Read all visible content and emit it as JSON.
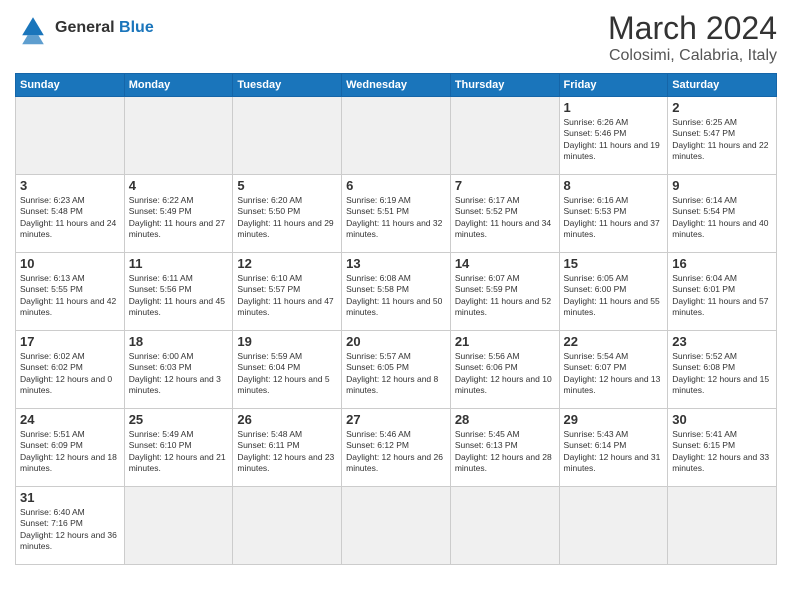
{
  "header": {
    "logo_line1": "General",
    "logo_line2": "Blue",
    "main_title": "March 2024",
    "subtitle": "Colosimi, Calabria, Italy"
  },
  "days_of_week": [
    "Sunday",
    "Monday",
    "Tuesday",
    "Wednesday",
    "Thursday",
    "Friday",
    "Saturday"
  ],
  "weeks": [
    [
      {
        "day": "",
        "info": "",
        "empty": true
      },
      {
        "day": "",
        "info": "",
        "empty": true
      },
      {
        "day": "",
        "info": "",
        "empty": true
      },
      {
        "day": "",
        "info": "",
        "empty": true
      },
      {
        "day": "",
        "info": "",
        "empty": true
      },
      {
        "day": "1",
        "info": "Sunrise: 6:26 AM\nSunset: 5:46 PM\nDaylight: 11 hours and 19 minutes.",
        "empty": false
      },
      {
        "day": "2",
        "info": "Sunrise: 6:25 AM\nSunset: 5:47 PM\nDaylight: 11 hours and 22 minutes.",
        "empty": false
      }
    ],
    [
      {
        "day": "3",
        "info": "Sunrise: 6:23 AM\nSunset: 5:48 PM\nDaylight: 11 hours and 24 minutes.",
        "empty": false
      },
      {
        "day": "4",
        "info": "Sunrise: 6:22 AM\nSunset: 5:49 PM\nDaylight: 11 hours and 27 minutes.",
        "empty": false
      },
      {
        "day": "5",
        "info": "Sunrise: 6:20 AM\nSunset: 5:50 PM\nDaylight: 11 hours and 29 minutes.",
        "empty": false
      },
      {
        "day": "6",
        "info": "Sunrise: 6:19 AM\nSunset: 5:51 PM\nDaylight: 11 hours and 32 minutes.",
        "empty": false
      },
      {
        "day": "7",
        "info": "Sunrise: 6:17 AM\nSunset: 5:52 PM\nDaylight: 11 hours and 34 minutes.",
        "empty": false
      },
      {
        "day": "8",
        "info": "Sunrise: 6:16 AM\nSunset: 5:53 PM\nDaylight: 11 hours and 37 minutes.",
        "empty": false
      },
      {
        "day": "9",
        "info": "Sunrise: 6:14 AM\nSunset: 5:54 PM\nDaylight: 11 hours and 40 minutes.",
        "empty": false
      }
    ],
    [
      {
        "day": "10",
        "info": "Sunrise: 6:13 AM\nSunset: 5:55 PM\nDaylight: 11 hours and 42 minutes.",
        "empty": false
      },
      {
        "day": "11",
        "info": "Sunrise: 6:11 AM\nSunset: 5:56 PM\nDaylight: 11 hours and 45 minutes.",
        "empty": false
      },
      {
        "day": "12",
        "info": "Sunrise: 6:10 AM\nSunset: 5:57 PM\nDaylight: 11 hours and 47 minutes.",
        "empty": false
      },
      {
        "day": "13",
        "info": "Sunrise: 6:08 AM\nSunset: 5:58 PM\nDaylight: 11 hours and 50 minutes.",
        "empty": false
      },
      {
        "day": "14",
        "info": "Sunrise: 6:07 AM\nSunset: 5:59 PM\nDaylight: 11 hours and 52 minutes.",
        "empty": false
      },
      {
        "day": "15",
        "info": "Sunrise: 6:05 AM\nSunset: 6:00 PM\nDaylight: 11 hours and 55 minutes.",
        "empty": false
      },
      {
        "day": "16",
        "info": "Sunrise: 6:04 AM\nSunset: 6:01 PM\nDaylight: 11 hours and 57 minutes.",
        "empty": false
      }
    ],
    [
      {
        "day": "17",
        "info": "Sunrise: 6:02 AM\nSunset: 6:02 PM\nDaylight: 12 hours and 0 minutes.",
        "empty": false
      },
      {
        "day": "18",
        "info": "Sunrise: 6:00 AM\nSunset: 6:03 PM\nDaylight: 12 hours and 3 minutes.",
        "empty": false
      },
      {
        "day": "19",
        "info": "Sunrise: 5:59 AM\nSunset: 6:04 PM\nDaylight: 12 hours and 5 minutes.",
        "empty": false
      },
      {
        "day": "20",
        "info": "Sunrise: 5:57 AM\nSunset: 6:05 PM\nDaylight: 12 hours and 8 minutes.",
        "empty": false
      },
      {
        "day": "21",
        "info": "Sunrise: 5:56 AM\nSunset: 6:06 PM\nDaylight: 12 hours and 10 minutes.",
        "empty": false
      },
      {
        "day": "22",
        "info": "Sunrise: 5:54 AM\nSunset: 6:07 PM\nDaylight: 12 hours and 13 minutes.",
        "empty": false
      },
      {
        "day": "23",
        "info": "Sunrise: 5:52 AM\nSunset: 6:08 PM\nDaylight: 12 hours and 15 minutes.",
        "empty": false
      }
    ],
    [
      {
        "day": "24",
        "info": "Sunrise: 5:51 AM\nSunset: 6:09 PM\nDaylight: 12 hours and 18 minutes.",
        "empty": false
      },
      {
        "day": "25",
        "info": "Sunrise: 5:49 AM\nSunset: 6:10 PM\nDaylight: 12 hours and 21 minutes.",
        "empty": false
      },
      {
        "day": "26",
        "info": "Sunrise: 5:48 AM\nSunset: 6:11 PM\nDaylight: 12 hours and 23 minutes.",
        "empty": false
      },
      {
        "day": "27",
        "info": "Sunrise: 5:46 AM\nSunset: 6:12 PM\nDaylight: 12 hours and 26 minutes.",
        "empty": false
      },
      {
        "day": "28",
        "info": "Sunrise: 5:45 AM\nSunset: 6:13 PM\nDaylight: 12 hours and 28 minutes.",
        "empty": false
      },
      {
        "day": "29",
        "info": "Sunrise: 5:43 AM\nSunset: 6:14 PM\nDaylight: 12 hours and 31 minutes.",
        "empty": false
      },
      {
        "day": "30",
        "info": "Sunrise: 5:41 AM\nSunset: 6:15 PM\nDaylight: 12 hours and 33 minutes.",
        "empty": false
      }
    ],
    [
      {
        "day": "31",
        "info": "Sunrise: 6:40 AM\nSunset: 7:16 PM\nDaylight: 12 hours and 36 minutes.",
        "empty": false
      },
      {
        "day": "",
        "info": "",
        "empty": true
      },
      {
        "day": "",
        "info": "",
        "empty": true
      },
      {
        "day": "",
        "info": "",
        "empty": true
      },
      {
        "day": "",
        "info": "",
        "empty": true
      },
      {
        "day": "",
        "info": "",
        "empty": true
      },
      {
        "day": "",
        "info": "",
        "empty": true
      }
    ]
  ]
}
